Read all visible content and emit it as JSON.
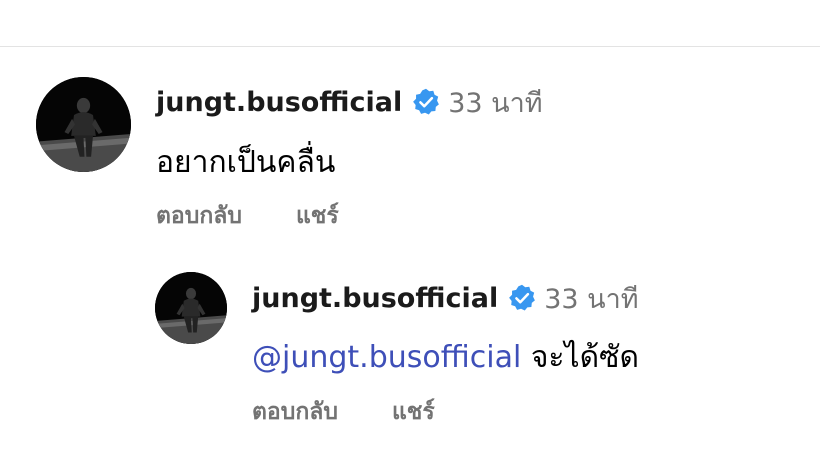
{
  "comments": [
    {
      "username": "jungt.busofficial",
      "timestamp": "33 นาที",
      "text": "อยากเป็นคลื่น",
      "actions": {
        "reply": "ตอบกลับ",
        "share": "แชร์"
      },
      "avatar_icon": "profile-photo",
      "verified_icon": "verified-badge-icon"
    },
    {
      "username": "jungt.busofficial",
      "timestamp": "33 นาที",
      "mention": "@jungt.busofficial",
      "text": "จะได้ซัด",
      "actions": {
        "reply": "ตอบกลับ",
        "share": "แชร์"
      },
      "avatar_icon": "profile-photo",
      "verified_icon": "verified-badge-icon"
    }
  ],
  "colors": {
    "verified": "#3897f0",
    "mention": "#3e4fb8",
    "muted": "#737373",
    "divider": "#e3e3e3"
  }
}
